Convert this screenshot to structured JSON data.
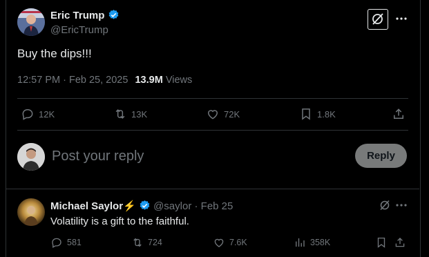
{
  "tweet": {
    "author_name": "Eric Trump",
    "author_handle": "@EricTrump",
    "text": "Buy the dips!!!",
    "time": "12:57 PM",
    "sep": " · ",
    "date": "Feb 25, 2025",
    "views_count": "13.9M",
    "views_label": "Views",
    "replies": "12K",
    "reposts": "13K",
    "likes": "72K",
    "bookmarks": "1.8K"
  },
  "reply_composer": {
    "placeholder": "Post your reply",
    "button_label": "Reply"
  },
  "reply": {
    "author_name": "Michael Saylor⚡",
    "author_handle": "@saylor",
    "sep": " · ",
    "date": "Feb 25",
    "text": "Volatility is a gift to the faithful.",
    "replies": "581",
    "reposts": "724",
    "likes": "7.6K",
    "views": "358K"
  },
  "colors": {
    "background": "#000000",
    "text": "#e7e9ea",
    "muted": "#71767b",
    "verified": "#1d9bf0",
    "border": "#2f3336",
    "reply_button_bg": "#787a7a"
  },
  "icons": [
    "verified-badge-icon",
    "grok-icon",
    "more-icon",
    "reply-icon",
    "repost-icon",
    "like-icon",
    "bookmark-icon",
    "share-icon",
    "views-icon"
  ]
}
